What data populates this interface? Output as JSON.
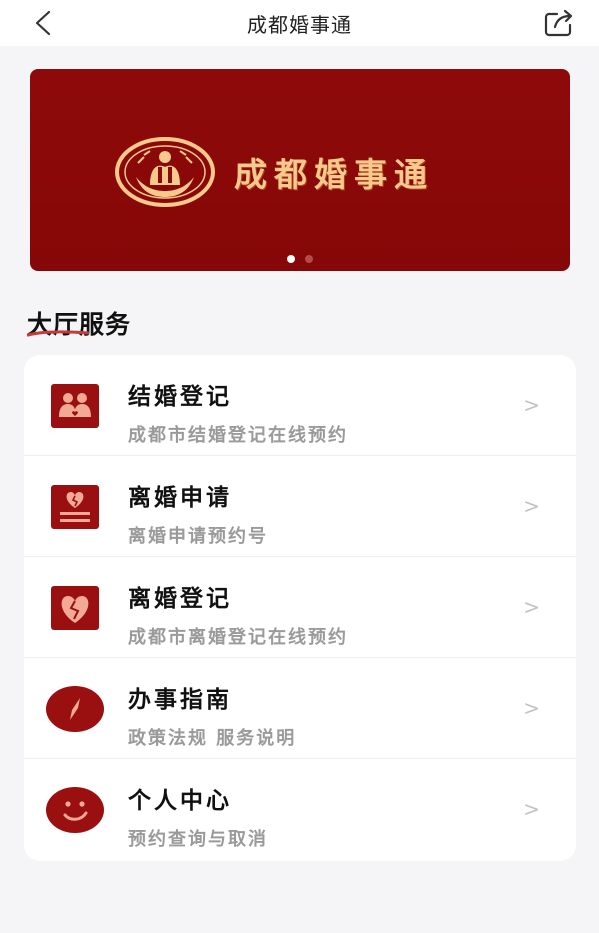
{
  "header": {
    "title": "成都婚事通",
    "back_icon": "chevron-left-icon",
    "share_icon": "share-icon"
  },
  "banner": {
    "brand_text": "成都婚事通",
    "slides": 2,
    "active_slide": 1,
    "background": "#8e0a0a",
    "brand_color": "#f6c98c"
  },
  "section": {
    "title": "大厅服务"
  },
  "services": [
    {
      "title": "结婚登记",
      "subtitle": "成都市结婚登记在线预约",
      "icon": "couple-icon"
    },
    {
      "title": "离婚申请",
      "subtitle": "离婚申请预约号",
      "icon": "broken-heart-form-icon"
    },
    {
      "title": "离婚登记",
      "subtitle": "成都市离婚登记在线预约",
      "icon": "broken-heart-icon"
    },
    {
      "title": "办事指南",
      "subtitle": "政策法规 服务说明",
      "icon": "compass-icon"
    },
    {
      "title": "个人中心",
      "subtitle": "预约查询与取消",
      "icon": "smiley-icon"
    }
  ],
  "chevron": ">",
  "colors": {
    "accent": "#9a0f0f",
    "muted_text": "#9a9a9a"
  }
}
